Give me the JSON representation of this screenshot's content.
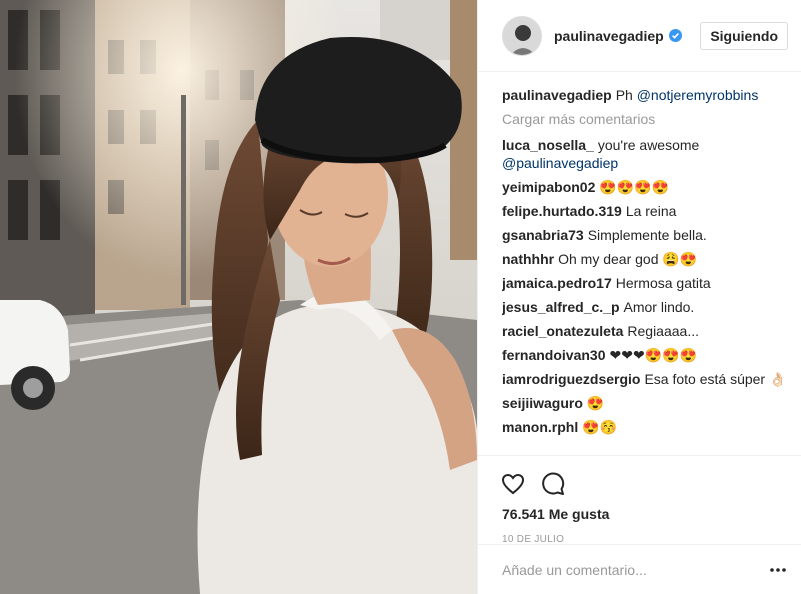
{
  "post": {
    "username": "paulinavegadiep",
    "follow_label": "Siguiendo",
    "caption_author": "paulinavegadiep",
    "caption_text": "Ph",
    "caption_mention": "@notjeremyrobbins",
    "load_more_label": "Cargar más comentarios",
    "likes": "76.541 Me gusta",
    "date": "10 DE JULIO",
    "add_comment_placeholder": "Añade un comentario..."
  },
  "comments": [
    {
      "author": "luca_nosella_",
      "text": "you're awesome",
      "mention": "@paulinavegadiep"
    },
    {
      "author": "yeimipabon02",
      "text": "😍😍😍😍"
    },
    {
      "author": "felipe.hurtado.319",
      "text": "La reina"
    },
    {
      "author": "gsanabria73",
      "text": "Simplemente bella."
    },
    {
      "author": "nathhhr",
      "text": "Oh my dear god 😩😍"
    },
    {
      "author": "jamaica.pedro17",
      "text": "Hermosa gatita"
    },
    {
      "author": "jesus_alfred_c._p",
      "text": "Amor lindo."
    },
    {
      "author": "raciel_onatezuleta",
      "text": "Regiaaaa..."
    },
    {
      "author": "fernandoivan30",
      "text": "❤❤❤😍😍😍"
    },
    {
      "author": "iamrodriguezdsergio",
      "text": "Esa foto está súper 👌🏻"
    },
    {
      "author": "seijiiwaguro",
      "text": "😍"
    },
    {
      "author": "manon.rphl",
      "text": "😍😚"
    }
  ],
  "colors": {
    "text": "#262626",
    "muted": "#999999",
    "mention": "#003569",
    "border": "#efefef",
    "verified": "#3897f0"
  },
  "icons": [
    "verified-badge-icon",
    "heart-icon",
    "comment-icon",
    "more-options-icon"
  ]
}
